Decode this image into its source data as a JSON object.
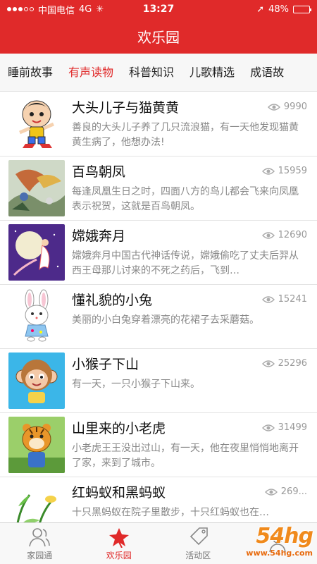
{
  "status": {
    "carrier": "中国电信",
    "network": "4G",
    "time": "13:27",
    "battery": "48%",
    "battery_level": 0.48
  },
  "header": {
    "title": "欢乐园"
  },
  "tabs": [
    {
      "label": "睡前故事",
      "active": false
    },
    {
      "label": "有声读物",
      "active": true
    },
    {
      "label": "科普知识",
      "active": false
    },
    {
      "label": "儿歌精选",
      "active": false
    },
    {
      "label": "成语故",
      "active": false
    }
  ],
  "stories": [
    {
      "title": "大头儿子与猫黄黄",
      "views": "9990",
      "desc": "善良的大头儿子养了几只流浪猫，有一天他发现猫黄黄生病了，他想办法!",
      "thumb": "boy-running"
    },
    {
      "title": "百鸟朝凤",
      "views": "15959",
      "desc": "每逢凤凰生日之时，四面八方的鸟儿都会飞来向凤凰表示祝贺，这就是百鸟朝凤。",
      "thumb": "phoenix-painting"
    },
    {
      "title": "嫦娥奔月",
      "views": "12690",
      "desc": "嫦娥奔月中国古代神话传说，嫦娥偷吃了丈夫后羿从西王母那儿讨来的不死之药后，飞到…",
      "thumb": "moon-fairy"
    },
    {
      "title": "懂礼貌的小兔",
      "views": "15241",
      "desc": "美丽的小白兔穿着漂亮的花裙子去采蘑菇。",
      "thumb": "rabbit"
    },
    {
      "title": "小猴子下山",
      "views": "25296",
      "desc": "有一天，一只小猴子下山来。",
      "thumb": "monkey"
    },
    {
      "title": "山里来的小老虎",
      "views": "31499",
      "desc": "小老虎王王没出过山，有一天，他在夜里悄悄地离开了家，来到了城市。",
      "thumb": "tiger"
    },
    {
      "title": "红蚂蚁和黑蚂蚁",
      "views": "269...",
      "desc": "十只黑蚂蚁在院子里散步，十只红蚂蚁也在…",
      "thumb": "ants-plants"
    }
  ],
  "bottom_nav": [
    {
      "label": "家园通",
      "icon": "people-icon",
      "active": false
    },
    {
      "label": "欢乐园",
      "icon": "star-icon",
      "active": true
    },
    {
      "label": "活动区",
      "icon": "tag-icon",
      "active": false
    },
    {
      "label": "",
      "icon": "person-icon",
      "active": false
    }
  ],
  "watermark": {
    "logo": "54hg",
    "url": "www.54hg.com"
  },
  "colors": {
    "accent": "#e02a2a",
    "muted": "#888888"
  }
}
